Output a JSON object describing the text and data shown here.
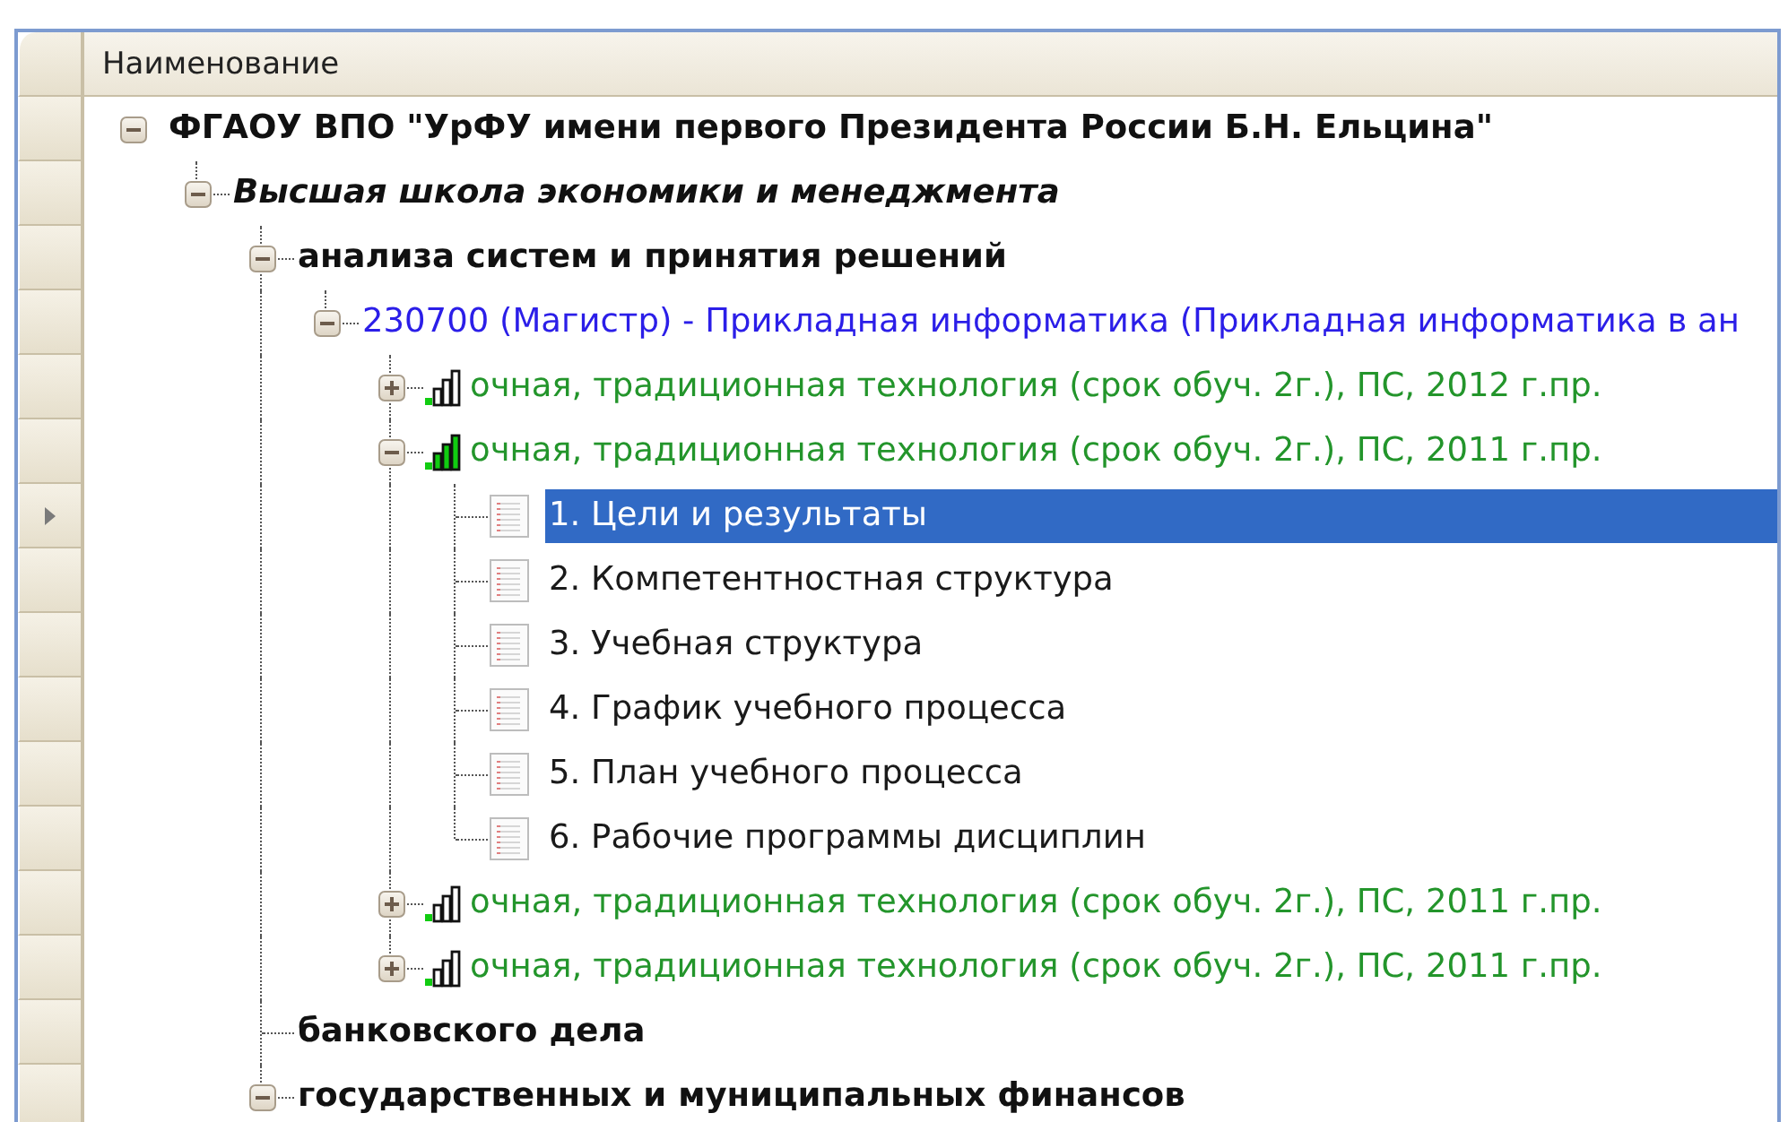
{
  "column_header": "Наименование",
  "tree": [
    {
      "kind": "organization",
      "label": "ФГАОУ ВПО \"УрФУ имени первого Президента России Б.Н. Ельцина\"",
      "expanded": true,
      "selected": false,
      "children": [
        {
          "kind": "school",
          "label": "Высшая школа экономики и менеджмента",
          "expanded": true,
          "selected": false,
          "children": [
            {
              "kind": "department",
              "label": "анализа систем и принятия решений",
              "expanded": true,
              "selected": false,
              "children": [
                {
                  "kind": "program",
                  "label": "230700 (Магистр) - Прикладная информатика (Прикладная информатика в ан",
                  "expanded": true,
                  "selected": false,
                  "children": [
                    {
                      "kind": "plan",
                      "label": "очная, традиционная технология (срок обуч. 2г.), ПС, 2012 г.пр.",
                      "expanded": false,
                      "selected": false,
                      "complete": false
                    },
                    {
                      "kind": "plan",
                      "label": "очная, традиционная технология (срок обуч. 2г.), ПС, 2011 г.пр.",
                      "expanded": true,
                      "selected": false,
                      "complete": true,
                      "children": [
                        {
                          "kind": "document",
                          "label": "1. Цели и результаты",
                          "selected": true
                        },
                        {
                          "kind": "document",
                          "label": "2. Компетентностная структура",
                          "selected": false
                        },
                        {
                          "kind": "document",
                          "label": "3. Учебная структура",
                          "selected": false
                        },
                        {
                          "kind": "document",
                          "label": "4. График учебного процесса",
                          "selected": false
                        },
                        {
                          "kind": "document",
                          "label": "5. План учебного процесса",
                          "selected": false
                        },
                        {
                          "kind": "document",
                          "label": "6. Рабочие программы дисциплин",
                          "selected": false
                        }
                      ]
                    },
                    {
                      "kind": "plan",
                      "label": "очная, традиционная технология (срок обуч. 2г.), ПС, 2011 г.пр.",
                      "expanded": false,
                      "selected": false,
                      "complete": false
                    },
                    {
                      "kind": "plan",
                      "label": "очная, традиционная технология (срок обуч. 2г.), ПС, 2011 г.пр.",
                      "expanded": false,
                      "selected": false,
                      "complete": false
                    }
                  ]
                }
              ]
            },
            {
              "kind": "department",
              "label": "банковского дела",
              "selected": false
            },
            {
              "kind": "department",
              "label": "государственных и муниципальных финансов",
              "expanded": true,
              "selected": false
            }
          ]
        }
      ]
    }
  ]
}
